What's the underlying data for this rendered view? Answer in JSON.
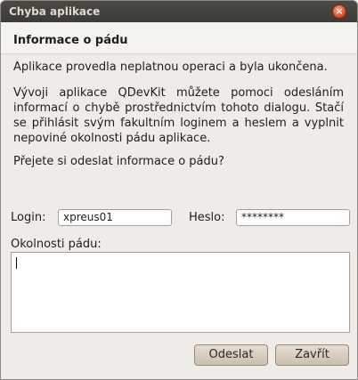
{
  "window": {
    "title": "Chyba aplikace",
    "close_glyph": "×"
  },
  "header": {
    "title": "Informace o pádu"
  },
  "messages": {
    "line1": "Aplikace provedla neplatnou operaci a byla ukončena.",
    "line2": "Vývoji aplikace QDevKit můžete pomoci odesláním informací o chybě prostřednictvím tohoto dialogu. Stačí se přihlásit svým fakultním loginem a heslem a vyplnit nepoviné okolnosti pádu aplikace.",
    "line3": "Přejete si odeslat informace o pádu?"
  },
  "form": {
    "login_label": "Login:",
    "login_value": "xpreus01",
    "password_label": "Heslo:",
    "password_value": "********",
    "details_label": "Okolnosti pádu:",
    "details_value": ""
  },
  "buttons": {
    "send": "Odeslat",
    "close": "Zavřít"
  },
  "colors": {
    "titlebar": "#3c3b37",
    "window_bg": "#efebe7",
    "close_button": "#e4532c"
  }
}
